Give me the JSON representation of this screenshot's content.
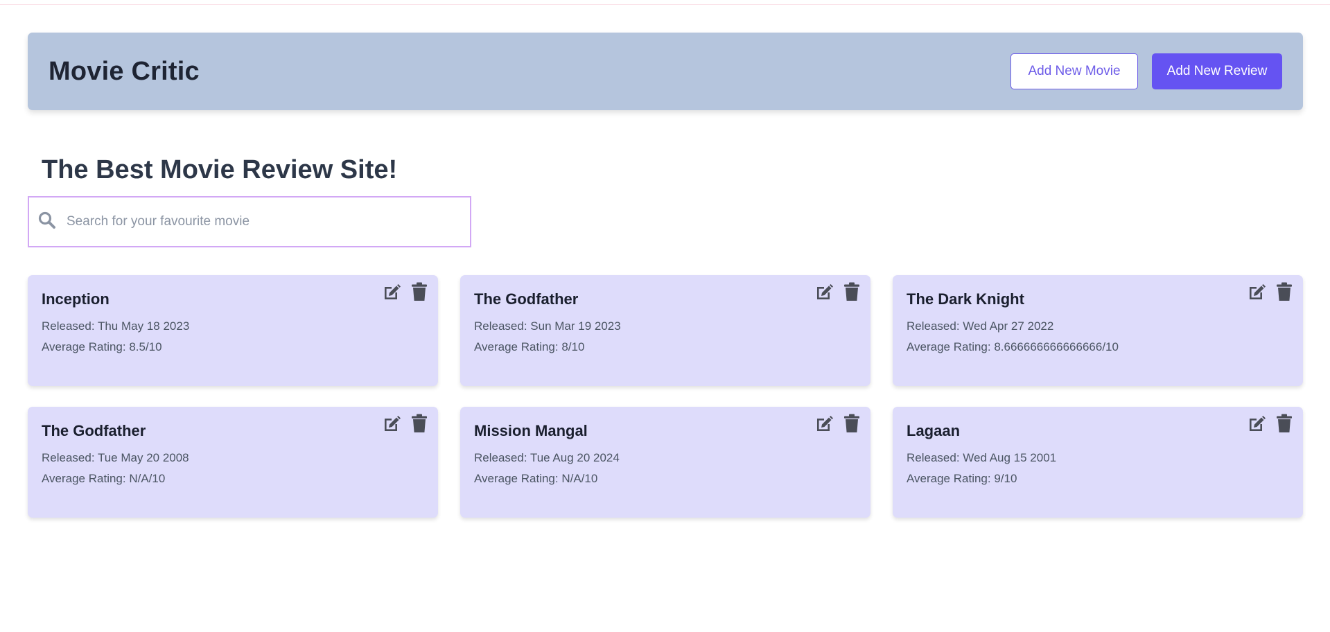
{
  "header": {
    "title": "Movie Critic",
    "add_movie_label": "Add New Movie",
    "add_review_label": "Add New Review"
  },
  "hero": {
    "title": "The Best Movie Review Site!"
  },
  "search": {
    "placeholder": "Search for your favourite movie",
    "value": ""
  },
  "icons": {
    "search": "search-icon",
    "edit": "edit-icon",
    "delete": "trash-icon"
  },
  "colors": {
    "header_bg": "#b5c5dd",
    "card_bg": "#dedcfb",
    "accent": "#6553f2",
    "search_border": "#d2a8f5"
  },
  "movies": [
    {
      "title": "Inception",
      "released": "Released: Thu May 18 2023",
      "rating": "Average Rating: 8.5/10"
    },
    {
      "title": "The Godfather",
      "released": "Released: Sun Mar 19 2023",
      "rating": "Average Rating: 8/10"
    },
    {
      "title": "The Dark Knight",
      "released": "Released: Wed Apr 27 2022",
      "rating": "Average Rating: 8.666666666666666/10"
    },
    {
      "title": "The Godfather",
      "released": "Released: Tue May 20 2008",
      "rating": "Average Rating: N/A/10"
    },
    {
      "title": "Mission Mangal",
      "released": "Released: Tue Aug 20 2024",
      "rating": "Average Rating: N/A/10"
    },
    {
      "title": "Lagaan",
      "released": "Released: Wed Aug 15 2001",
      "rating": "Average Rating: 9/10"
    }
  ]
}
